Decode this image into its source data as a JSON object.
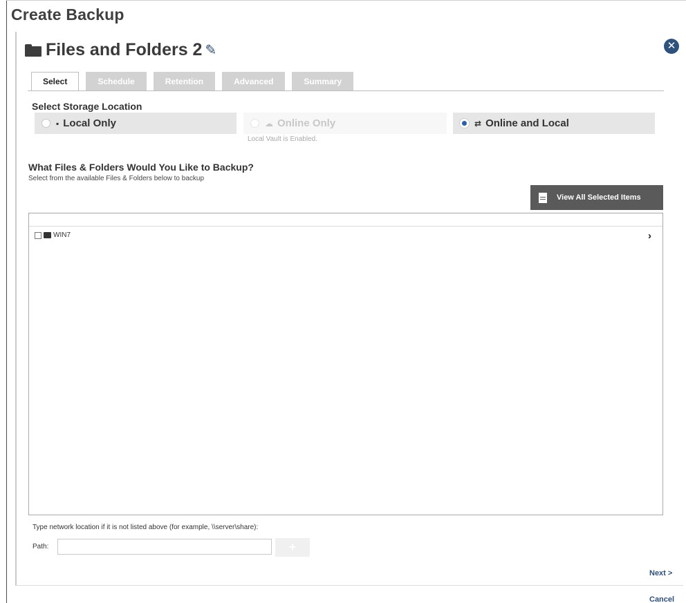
{
  "app": {
    "title": "Create Backup"
  },
  "job": {
    "name": "Files and Folders 2",
    "edit_icon": "pencil-icon",
    "folder_icon": "folder-icon",
    "close_icon": "close-circle-icon"
  },
  "tabs": [
    {
      "label": "Select",
      "active": true
    },
    {
      "label": "Schedule",
      "active": false
    },
    {
      "label": "Retention",
      "active": false
    },
    {
      "label": "Advanced",
      "active": false
    },
    {
      "label": "Summary",
      "active": false
    }
  ],
  "storage": {
    "heading": "Select Storage Location",
    "options": [
      {
        "label": "Local Only",
        "selected": false,
        "enabled": true,
        "icon": "drive-icon"
      },
      {
        "label": "Online Only",
        "selected": false,
        "enabled": false,
        "icon": "cloud-icon"
      },
      {
        "label": "Online and Local",
        "selected": true,
        "enabled": true,
        "icon": "sync-icon"
      }
    ],
    "note": "Local Vault is Enabled."
  },
  "files": {
    "heading": "What Files & Folders Would You Like to Backup?",
    "subheading": "Select from the available Files & Folders below to backup",
    "view_all_label": "View All Selected Items",
    "tree": [
      {
        "label": "WIN7",
        "checked": false,
        "icon": "computer-icon",
        "expand_glyph": "›"
      }
    ]
  },
  "network": {
    "hint": "Type network location if it is not listed above (for example, \\\\server\\share):",
    "path_label": "Path:",
    "path_value": "",
    "add_label": "+"
  },
  "footer": {
    "next_label": "Next >",
    "cancel_label": "Cancel"
  },
  "colors": {
    "accent": "#2f527c",
    "link": "#2f4f77",
    "selected_radio": "#2c5fa8",
    "button_dark": "#5a5a5a"
  }
}
